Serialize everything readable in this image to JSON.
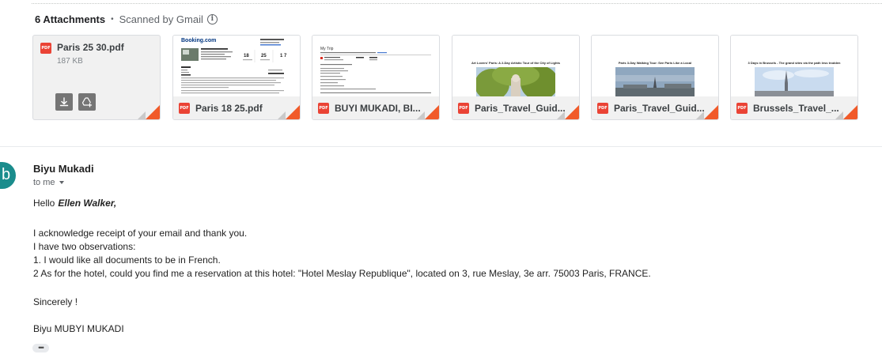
{
  "attachments": {
    "count_label": "6 Attachments",
    "separator": "•",
    "scanned_label": "Scanned by Gmail",
    "info_glyph": "i",
    "items": [
      {
        "name": "Paris 25 30.pdf",
        "size": "187 KB",
        "type_badge": "PDF"
      },
      {
        "name": "Paris 18 25.pdf",
        "type_badge": "PDF",
        "thumb_brand": "Booking.com"
      },
      {
        "name": "BUYI MUKADI, BI...",
        "type_badge": "PDF",
        "thumb_heading": "My Trip"
      },
      {
        "name": "Paris_Travel_Guid...",
        "type_badge": "PDF",
        "thumb_heading": "Art Lovers' Paris: A 2-Day Artistic Tour of the City of Lights"
      },
      {
        "name": "Paris_Travel_Guid...",
        "type_badge": "PDF",
        "thumb_heading": "Paris 3-Day Walking Tour: See Paris Like a Local"
      },
      {
        "name": "Brussels_Travel_...",
        "type_badge": "PDF",
        "thumb_heading": "3 Days in Brussels - The grand sites via the path less trodden"
      }
    ]
  },
  "email": {
    "avatar_letter": "b",
    "sender": "Biyu Mukadi",
    "recipient_label": "to me",
    "greeting": "Hello",
    "greeting_name": "Ellen Walker,",
    "lines": [
      "I acknowledge receipt of your email and thank you.",
      "I have two observations:",
      "1. I would like all documents to be in French.",
      "2 As for the hotel, could you find me a reservation at this hotel: \"Hotel Meslay Republique\", located on 3, rue Meslay, 3e arr. 75003 Paris, FRANCE."
    ],
    "closing": "Sincerely !",
    "signature": "Biyu MUBYI MUKADI",
    "trimmed_label": "•••"
  },
  "colors": {
    "pdf_red": "#ea4335",
    "corner_orange": "#f15a29",
    "avatar_teal": "#1a8c8c",
    "booking_blue": "#003580"
  }
}
